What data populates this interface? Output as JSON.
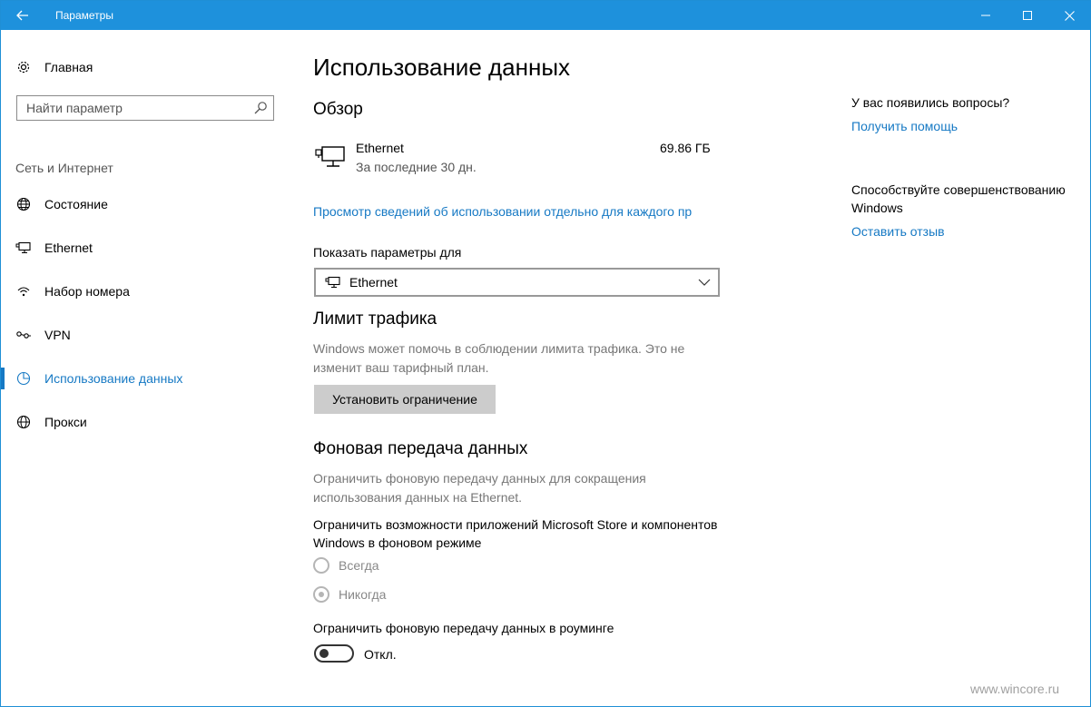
{
  "window": {
    "title": "Параметры",
    "accent": "#1e91dc",
    "link_color": "#1679c4"
  },
  "sidebar": {
    "home": {
      "label": "Главная",
      "icon": "gear-icon"
    },
    "search": {
      "placeholder": "Найти параметр",
      "icon": "search-icon"
    },
    "section_label": "Сеть и Интернет",
    "items": [
      {
        "label": "Состояние",
        "icon": "globe-status-icon",
        "active": false
      },
      {
        "label": "Ethernet",
        "icon": "ethernet-icon",
        "active": false
      },
      {
        "label": "Набор номера",
        "icon": "dialup-icon",
        "active": false
      },
      {
        "label": "VPN",
        "icon": "vpn-icon",
        "active": false
      },
      {
        "label": "Использование данных",
        "icon": "data-usage-icon",
        "active": true
      },
      {
        "label": "Прокси",
        "icon": "globe-icon",
        "active": false
      }
    ]
  },
  "main": {
    "title": "Использование данных",
    "overview": {
      "heading": "Обзор",
      "connection": "Ethernet",
      "period": "За последние 30 дн.",
      "amount": "69.86 ГБ",
      "details_link": "Просмотр сведений об использовании отдельно для каждого пр"
    },
    "show_settings": {
      "label": "Показать параметры для",
      "selected": "Ethernet"
    },
    "limit": {
      "heading": "Лимит трафика",
      "description": "Windows может помочь в соблюдении лимита трафика. Это не изменит ваш тарифный план.",
      "button": "Установить ограничение"
    },
    "background": {
      "heading": "Фоновая передача данных",
      "description": "Ограничить фоновую передачу данных для сокращения использования данных на Ethernet.",
      "restrict_label": "Ограничить возможности приложений Microsoft Store и компонентов Windows в фоновом режиме",
      "options": [
        {
          "label": "Всегда",
          "checked": false
        },
        {
          "label": "Никогда",
          "checked": true
        }
      ],
      "roaming_label": "Ограничить фоновую передачу данных в роуминге",
      "roaming_toggle": "Откл."
    }
  },
  "aside": {
    "questions": "У вас появились вопросы?",
    "help_link": "Получить помощь",
    "improve": "Способствуйте совершенствованию Windows",
    "feedback_link": "Оставить отзыв"
  },
  "watermark": "www.wincore.ru"
}
